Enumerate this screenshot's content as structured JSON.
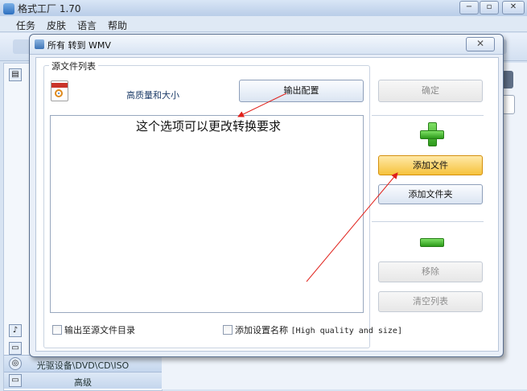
{
  "app": {
    "title": "格式工厂 1.70",
    "window_controls": [
      "−",
      "▫",
      "✕"
    ]
  },
  "menu": {
    "items": [
      "任务",
      "皮肤",
      "语言",
      "帮助"
    ]
  },
  "left_panel": {
    "device_row": "光驱设备\\DVD\\CD\\ISO",
    "advanced_row": "高级"
  },
  "dialog": {
    "title": "所有 转到 WMV",
    "close": "✕",
    "group_label": "源文件列表",
    "quality_label": "高质量和大小",
    "output_config_button": "输出配置",
    "ok_button": "确定",
    "add_file_button": "添加文件",
    "add_folder_button": "添加文件夹",
    "remove_button": "移除",
    "clear_list_button": "清空列表",
    "annotation": "这个选项可以更改转换要求",
    "checkbox_output_to_source": "输出至源文件目录",
    "checkbox_add_setting_name": "添加设置名称",
    "checkbox_setting_tag": "[High quality and size]"
  },
  "colors": {
    "arrow": "#e0201a",
    "highlight": "#f6c23c",
    "green": "#2d9a1b"
  }
}
